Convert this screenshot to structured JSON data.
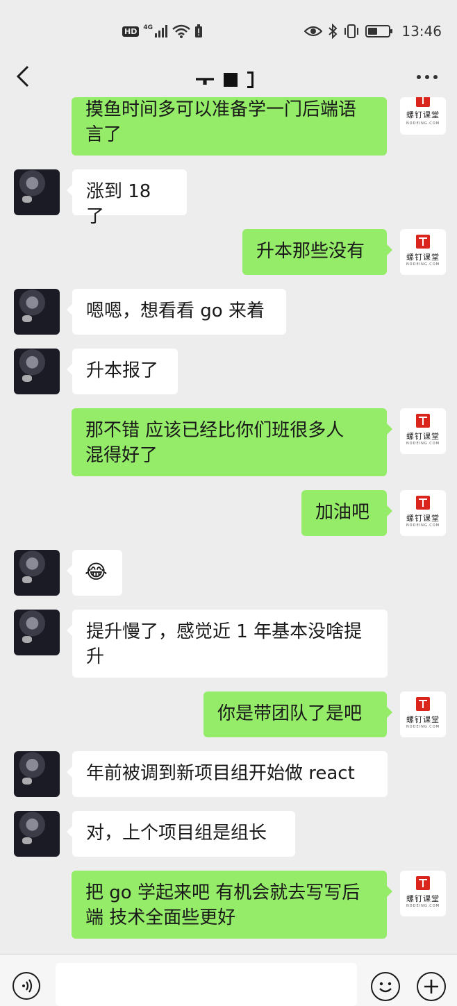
{
  "status_bar": {
    "hd": "HD",
    "network": "4G",
    "time": "13:46",
    "icons": [
      "hd-icon",
      "signal-icon",
      "wifi-icon",
      "alert-battery-icon",
      "eye-icon",
      "bluetooth-icon",
      "vibrate-icon",
      "battery-icon"
    ]
  },
  "header": {
    "back_icon": "chevron-left-icon",
    "more_icon": "more-dots-icon"
  },
  "brand": {
    "name": "螺钉课堂",
    "sub": "NODEING.COM",
    "logo_color": "#d9251b"
  },
  "colors": {
    "background": "#ededed",
    "sent_bubble": "#95ec69",
    "received_bubble": "#ffffff"
  },
  "messages": [
    {
      "side": "right",
      "lines": [
        "摸鱼时间多可以准备学一门后端语",
        "言了"
      ]
    },
    {
      "side": "left",
      "lines": [
        "涨到 18 了"
      ]
    },
    {
      "side": "right",
      "lines": [
        "升本那些没有"
      ]
    },
    {
      "side": "left",
      "lines": [
        "嗯嗯，想看看 go 来着"
      ]
    },
    {
      "side": "left",
      "lines": [
        "升本报了"
      ]
    },
    {
      "side": "right",
      "lines": [
        "那不错  应该已经比你们班很多人",
        "混得好了"
      ]
    },
    {
      "side": "right",
      "lines": [
        "加油吧"
      ]
    },
    {
      "side": "left",
      "lines": [
        "😂"
      ]
    },
    {
      "side": "left",
      "lines": [
        "提升慢了，感觉近 1 年基本没啥提",
        "升"
      ]
    },
    {
      "side": "right",
      "lines": [
        "你是带团队了是吧"
      ]
    },
    {
      "side": "left",
      "lines": [
        "年前被调到新项目组开始做 react"
      ]
    },
    {
      "side": "left",
      "lines": [
        "对，上个项目组是组长"
      ]
    },
    {
      "side": "right",
      "lines": [
        "把 go 学起来吧 有机会就去写写后",
        "端 技术全面些更好"
      ]
    }
  ],
  "input_bar": {
    "placeholder": "",
    "icons": [
      "voice-icon",
      "emoji-icon",
      "plus-icon"
    ]
  }
}
